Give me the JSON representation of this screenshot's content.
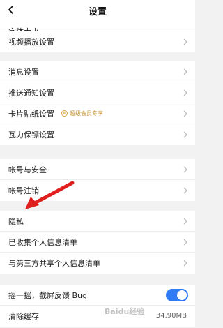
{
  "header": {
    "title": "设置",
    "back_icon": "chevron-left-icon"
  },
  "groups": [
    {
      "items": [
        {
          "label": "字体大小",
          "partial": true
        },
        {
          "label": "视频播放设置"
        }
      ]
    },
    {
      "items": [
        {
          "label": "消息设置"
        },
        {
          "label": "推送通知设置"
        },
        {
          "label": "卡片贴纸设置",
          "badge": "超级会员专享"
        },
        {
          "label": "瓦力保镖设置"
        }
      ]
    },
    {
      "items": [
        {
          "label": "帐号与安全"
        },
        {
          "label": "帐号注销"
        }
      ]
    },
    {
      "items": [
        {
          "label": "隐私"
        },
        {
          "label": "已收集个人信息清单"
        },
        {
          "label": "与第三方共享个人信息清单"
        }
      ]
    },
    {
      "items": [
        {
          "label": "摇一摇，截屏反馈 Bug",
          "toggle_on": true
        },
        {
          "label": "清除缓存",
          "value": "34.90MB"
        }
      ]
    }
  ],
  "watermark": "Baidu经验",
  "colors": {
    "accent": "#2f7bf5",
    "arrow": "#e0201e",
    "badge": "#c9963a",
    "background": "#f2f2f2"
  }
}
